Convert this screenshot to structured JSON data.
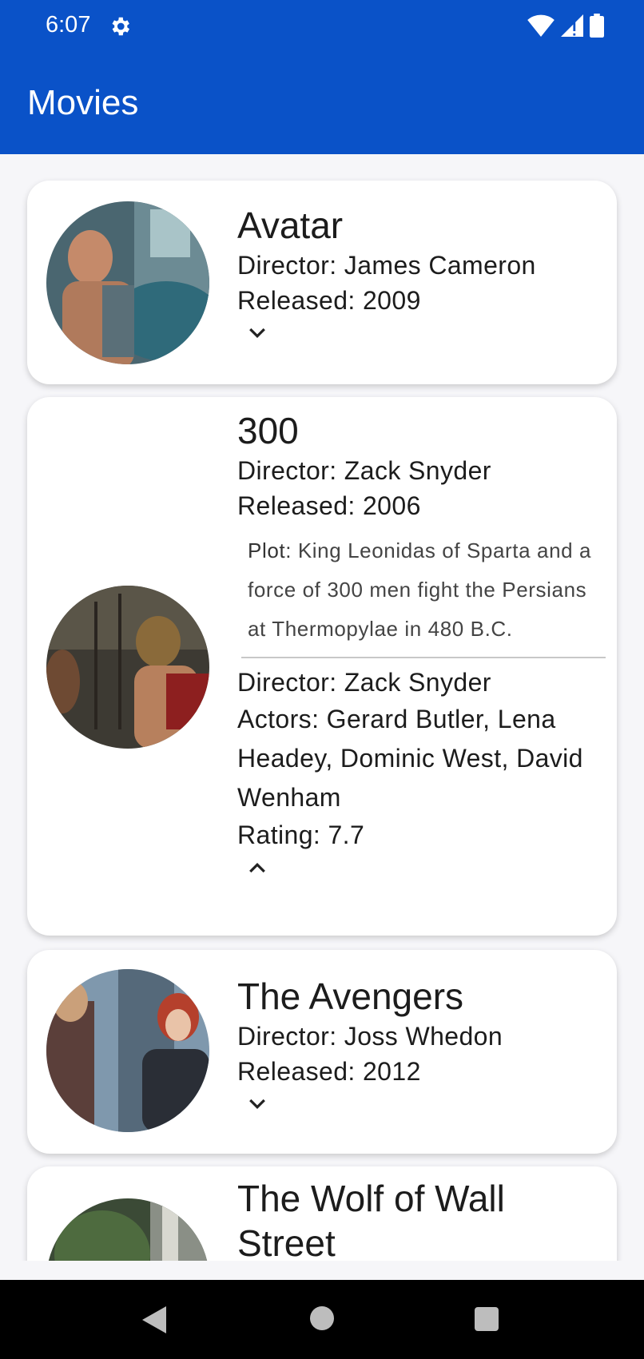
{
  "status_bar": {
    "time": "6:07",
    "icons": [
      "settings-gear-icon",
      "wifi-icon",
      "cell-signal-icon",
      "battery-icon"
    ]
  },
  "app_bar": {
    "title": "Movies"
  },
  "colors": {
    "primary": "#0a52c8",
    "background": "#f6f6f9",
    "card": "#ffffff"
  },
  "movies": [
    {
      "title": "Avatar",
      "director": "Director: James Cameron",
      "released": "Released: 2009",
      "expanded": false,
      "toggle_icon": "chevron-down-icon"
    },
    {
      "title": "300",
      "director": "Director: Zack Snyder",
      "released": "Released: 2006",
      "expanded": true,
      "plot_label": "Plot:",
      "plot": "King Leonidas of Sparta and a force of 300 men fight the Persians at Thermopylae in 480 B.C.",
      "details_director": "Director: Zack Snyder",
      "actors": "Actors: Gerard Butler, Lena Headey, Dominic West, David Wenham",
      "rating": "Rating: 7.7",
      "toggle_icon": "chevron-up-icon"
    },
    {
      "title": "The Avengers",
      "director": "Director: Joss Whedon",
      "released": "Released: 2012",
      "expanded": false,
      "toggle_icon": "chevron-down-icon"
    },
    {
      "title": "The Wolf of Wall Street",
      "expanded": false
    }
  ],
  "nav_bar": {
    "icons": [
      "back-icon",
      "home-icon",
      "recents-icon"
    ]
  }
}
